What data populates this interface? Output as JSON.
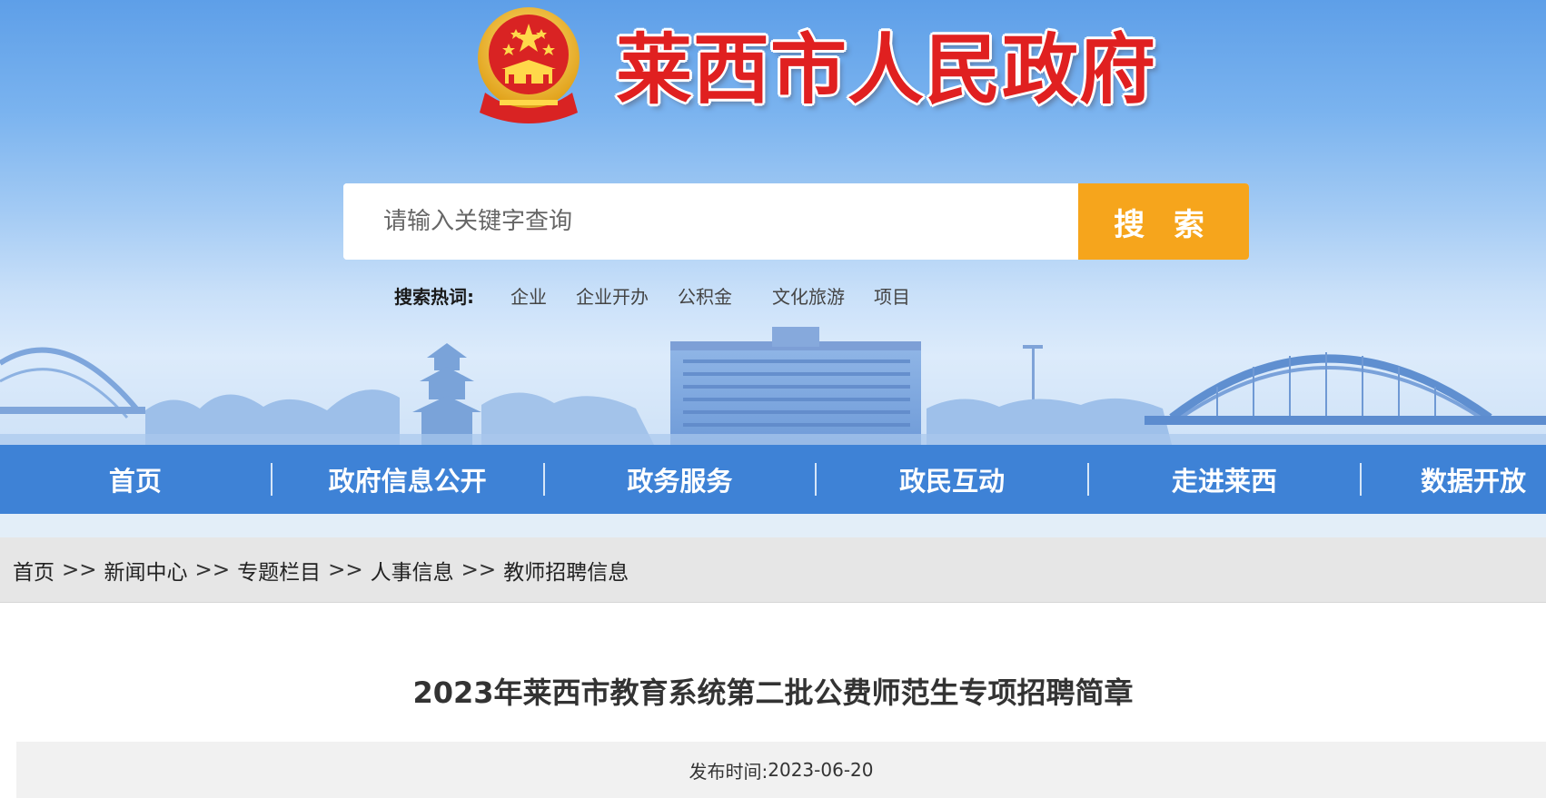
{
  "header": {
    "site_title": "莱西市人民政府",
    "emblem": "national-emblem"
  },
  "search": {
    "placeholder": "请输入关键字查询",
    "button_label": "搜 索",
    "hot_label": "搜索热词:",
    "hot_words": [
      "企业",
      "企业开办",
      "公积金",
      "文化旅游",
      "项目"
    ]
  },
  "nav": {
    "items": [
      "首页",
      "政府信息公开",
      "政务服务",
      "政民互动",
      "走进莱西",
      "数据开放"
    ]
  },
  "breadcrumb": {
    "items": [
      "首页",
      "新闻中心",
      "专题栏目",
      "人事信息",
      "教师招聘信息"
    ],
    "separator": ">>"
  },
  "article": {
    "title": "2023年莱西市教育系统第二批公费师范生专项招聘简章",
    "publish_label": "发布时间:",
    "publish_date": "2023-06-20"
  },
  "colors": {
    "title_red": "#e02020",
    "search_orange": "#f6a51c",
    "nav_blue": "#3e82d6"
  }
}
